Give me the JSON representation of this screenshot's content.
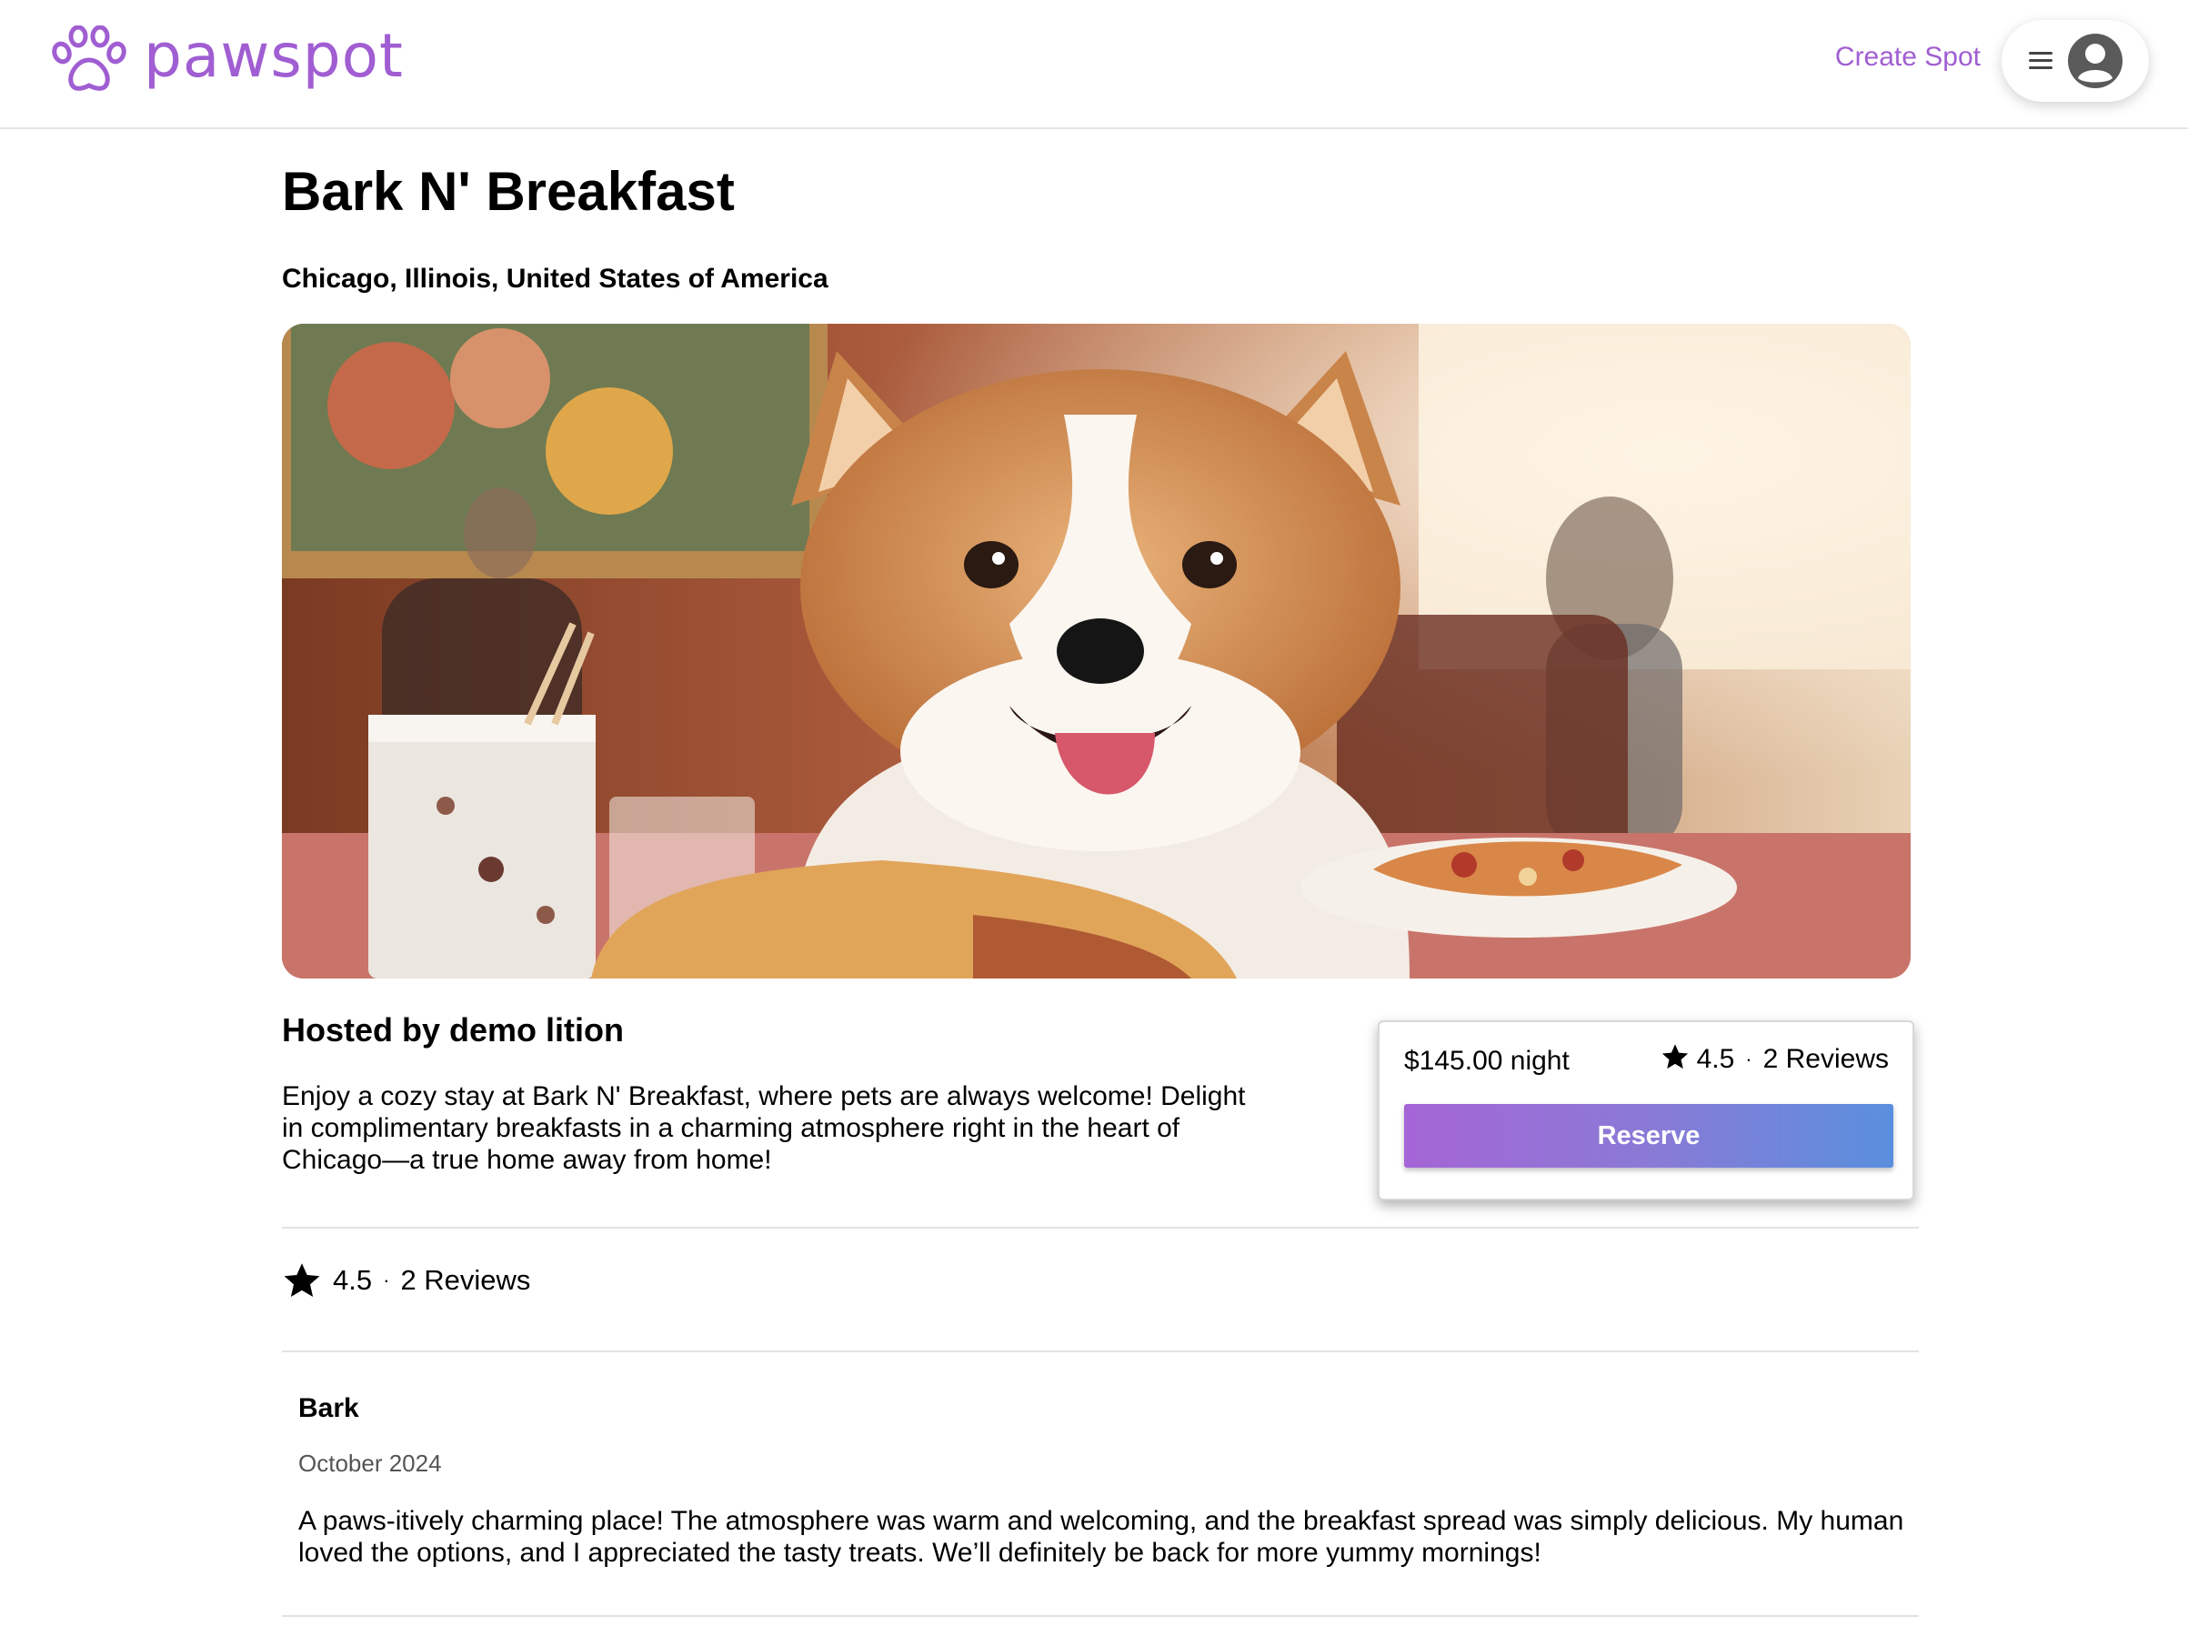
{
  "header": {
    "brand": "pawspot",
    "create_spot_label": "Create Spot"
  },
  "spot": {
    "title": "Bark N' Breakfast",
    "location": "Chicago, Illinois, United States of America",
    "host": "Hosted by demo lition",
    "description": "Enjoy a cozy stay at Bark N' Breakfast, where pets are always welcome! Delight in complimentary breakfasts in a charming atmosphere right in the heart of Chicago—a true home away from home!"
  },
  "booking": {
    "price": "$145.00 night",
    "rating": "4.5",
    "separator": "·",
    "reviews_count": "2 Reviews",
    "reserve_label": "Reserve"
  },
  "summary": {
    "rating": "4.5",
    "separator": "·",
    "reviews_count": "2 Reviews"
  },
  "reviews": [
    {
      "name": "Bark",
      "date": "October 2024",
      "text": "A paws-itively charming place! The atmosphere was warm and welcoming, and the breakfast spread was simply delicious. My human loved the options, and I appreciated the tasty treats. We’ll definitely be back for more yummy mornings!"
    }
  ],
  "colors": {
    "brand": "#a05ed2",
    "reserve_gradient_start": "#a565d6",
    "reserve_gradient_end": "#5a8fde"
  },
  "icons": {
    "logo": "paw-icon",
    "menu": "hamburger-icon",
    "avatar": "user-circle-icon",
    "rating": "star-icon"
  }
}
